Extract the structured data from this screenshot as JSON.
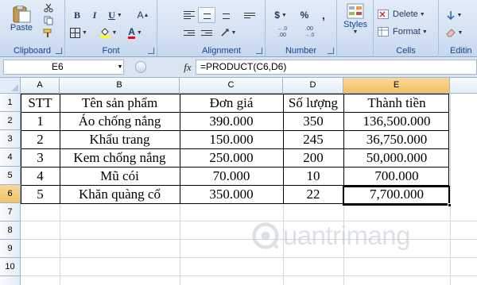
{
  "ribbon": {
    "clipboard": {
      "label": "Clipboard",
      "paste_label": "Paste"
    },
    "font": {
      "label": "Font",
      "bold": "B",
      "italic": "I",
      "underline": "U",
      "font_color_glyph": "A"
    },
    "alignment": {
      "label": "Alignment"
    },
    "number": {
      "label": "Number",
      "currency": "$",
      "percent": "%",
      "comma": ",",
      "inc_decimal": ".0→.00",
      "dec_decimal": ".00→.0"
    },
    "styles": {
      "label": "Styles"
    },
    "cells": {
      "label": "Cells",
      "delete_label": "Delete",
      "format_label": "Format"
    },
    "editing": {
      "label": "Editin"
    }
  },
  "formula_bar": {
    "name_box": "E6",
    "fx": "fx",
    "formula": "=PRODUCT(C6,D6)"
  },
  "sheet": {
    "columns": [
      "A",
      "B",
      "C",
      "D",
      "E"
    ],
    "active_column": "E",
    "rows": [
      "1",
      "2",
      "3",
      "4",
      "5",
      "6",
      "7",
      "8",
      "9",
      "10"
    ],
    "active_row": "6",
    "cells": [
      [
        "STT",
        "Tên sản phẩm",
        "Đơn giá",
        "Số lượng",
        "Thành tiền"
      ],
      [
        "1",
        "Áo chống nắng",
        "390.000",
        "350",
        "136,500.000"
      ],
      [
        "2",
        "Khẩu trang",
        "150.000",
        "245",
        "36,750.000"
      ],
      [
        "3",
        "Kem chống nắng",
        "250.000",
        "200",
        "50,000.000"
      ],
      [
        "4",
        "Mũ cói",
        "70.000",
        "10",
        "700.000"
      ],
      [
        "5",
        "Khăn quàng cổ",
        "350.000",
        "22",
        "7,700.000"
      ]
    ]
  },
  "watermark": {
    "text": "uantrimang"
  },
  "colors": {
    "ribbon_bg": "#d6e3f3",
    "header_active": "#f1c15f",
    "grid": "#d0d7e5"
  }
}
